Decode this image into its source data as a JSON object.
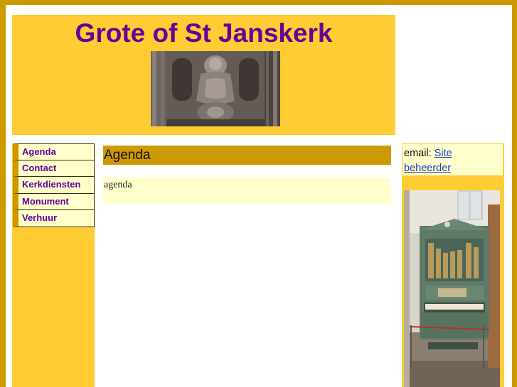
{
  "header": {
    "title": "Grote of St Janskerk",
    "photo_icon": "carved-woodwork-photo"
  },
  "nav": {
    "items": [
      {
        "label": "Agenda"
      },
      {
        "label": "Contact"
      },
      {
        "label": "Kerkdiensten"
      },
      {
        "label": "Monument"
      },
      {
        "label": "Verhuur"
      }
    ]
  },
  "main": {
    "heading": "Agenda",
    "body": "agenda"
  },
  "rightbar": {
    "email_label": "email:",
    "email_link_line1": "Site",
    "email_link_line2": "beheerder",
    "photo_icon": "church-organ-photo"
  },
  "colors": {
    "frame": "#cc9900",
    "header_bg": "#ffcc33",
    "title": "#660099",
    "panel_bg": "#ffffcc",
    "link": "#1a3cc8"
  }
}
